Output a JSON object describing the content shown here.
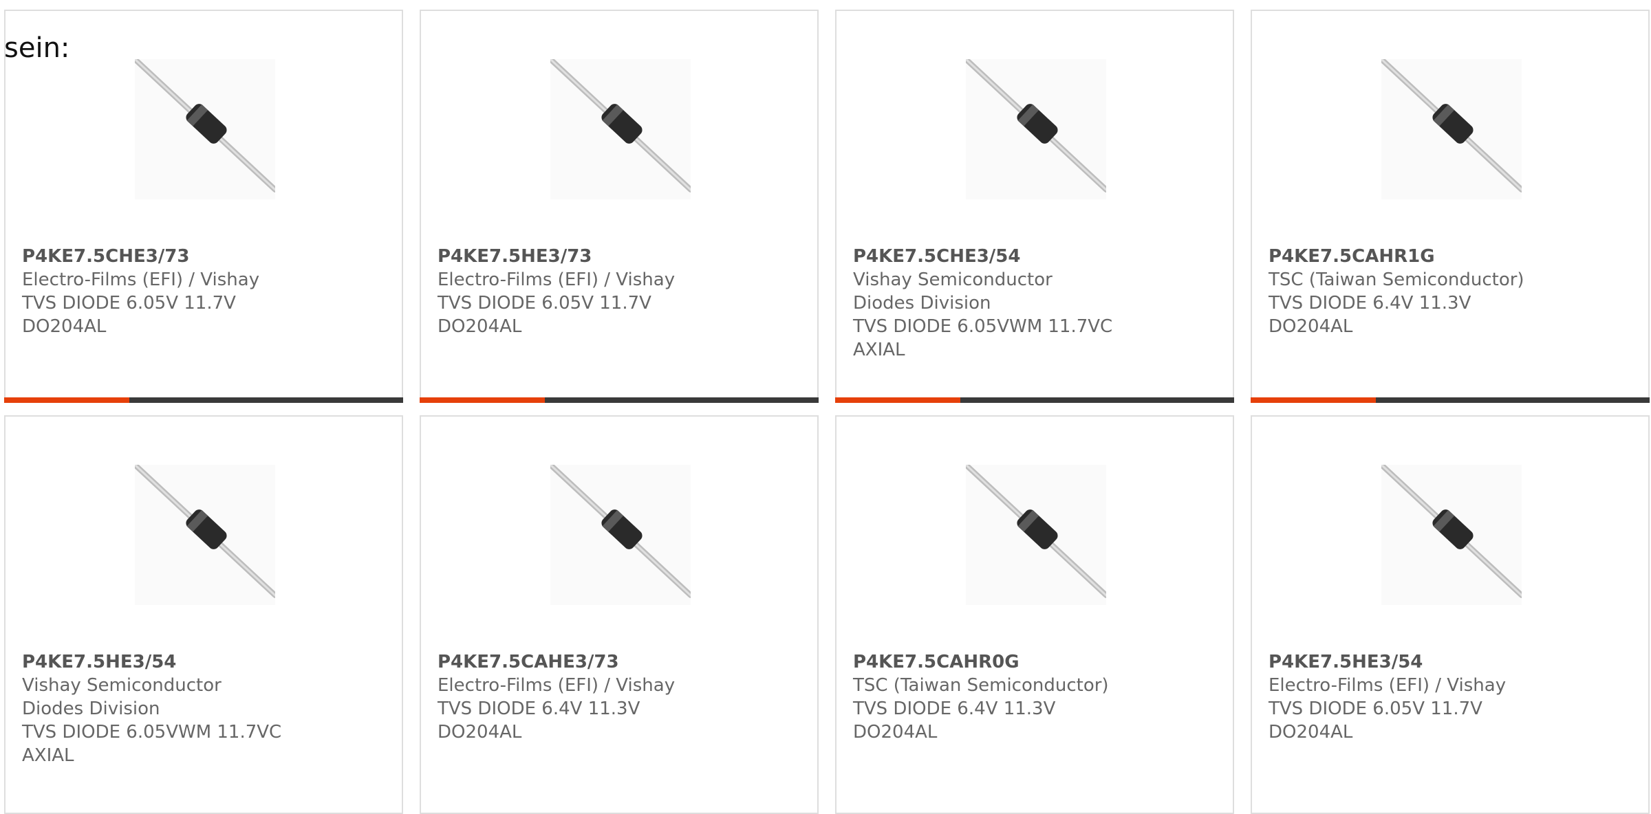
{
  "heading": "sein:",
  "accent_color": "#e6400a",
  "bar_color": "#3a3a3a",
  "products": [
    {
      "part": "P4KE7.5CHE3/73",
      "manufacturer": "Electro-Films (EFI) / Vishay",
      "description": "TVS DIODE 6.05V 11.7V DO204AL",
      "image": "axial-diode-icon"
    },
    {
      "part": "P4KE7.5HE3/73",
      "manufacturer": "Electro-Films (EFI) / Vishay",
      "description": "TVS DIODE 6.05V 11.7V DO204AL",
      "image": "axial-diode-icon"
    },
    {
      "part": "P4KE7.5CHE3/54",
      "manufacturer": "Vishay Semiconductor Diodes Division",
      "description": "TVS DIODE 6.05VWM 11.7VC AXIAL",
      "image": "axial-diode-icon"
    },
    {
      "part": "P4KE7.5CAHR1G",
      "manufacturer": "TSC (Taiwan Semiconductor)",
      "description": "TVS DIODE 6.4V 11.3V DO204AL",
      "image": "axial-diode-icon"
    },
    {
      "part": "P4KE7.5HE3/54",
      "manufacturer": "Vishay Semiconductor Diodes Division",
      "description": "TVS DIODE 6.05VWM 11.7VC AXIAL",
      "image": "axial-diode-icon"
    },
    {
      "part": "P4KE7.5CAHE3/73",
      "manufacturer": "Electro-Films (EFI) / Vishay",
      "description": "TVS DIODE 6.4V 11.3V DO204AL",
      "image": "axial-diode-icon"
    },
    {
      "part": "P4KE7.5CAHR0G",
      "manufacturer": "TSC (Taiwan Semiconductor)",
      "description": "TVS DIODE 6.4V 11.3V DO204AL",
      "image": "axial-diode-icon"
    },
    {
      "part": "P4KE7.5HE3/54",
      "manufacturer": "Electro-Films (EFI) / Vishay",
      "description": "TVS DIODE 6.05V 11.7V DO204AL",
      "image": "axial-diode-icon"
    }
  ]
}
